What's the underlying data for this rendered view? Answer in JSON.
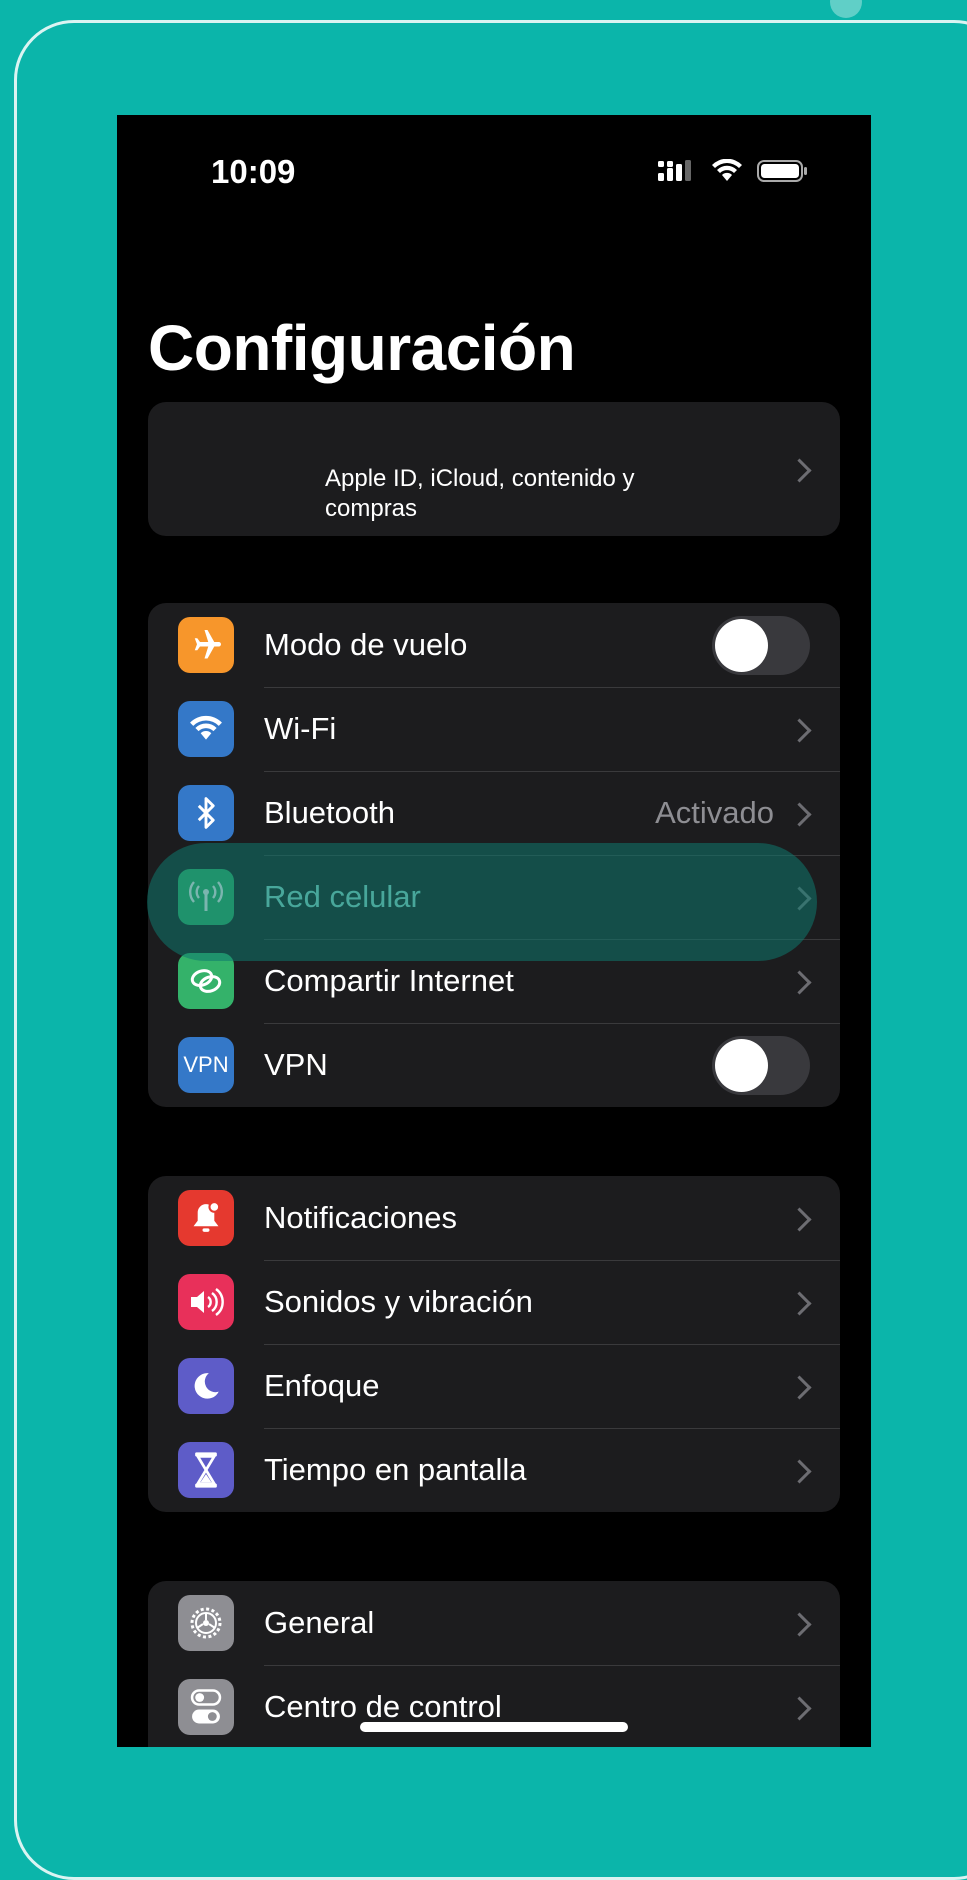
{
  "status_bar": {
    "time": "10:09"
  },
  "page": {
    "title": "Configuración"
  },
  "account": {
    "subtitle": "Apple ID, iCloud, contenido y compras"
  },
  "groups": {
    "connectivity": [
      {
        "label": "Modo de vuelo",
        "icon": "airplane-icon",
        "color": "#f7962b",
        "control": "toggle",
        "on": false
      },
      {
        "label": "Wi-Fi",
        "icon": "wifi-icon",
        "color": "#3478c8",
        "control": "chevron"
      },
      {
        "label": "Bluetooth",
        "value": "Activado",
        "icon": "bluetooth-icon",
        "color": "#3478c8",
        "control": "chevron"
      },
      {
        "label": "Red celular",
        "icon": "cellular-antenna-icon",
        "color": "#34b26a",
        "control": "chevron",
        "highlighted": true
      },
      {
        "label": "Compartir Internet",
        "icon": "hotspot-icon",
        "color": "#34b26a",
        "control": "chevron"
      },
      {
        "label": "VPN",
        "icon": "vpn-icon",
        "icon_text": "VPN",
        "color": "#3478c8",
        "control": "toggle",
        "on": false
      }
    ],
    "notifications": [
      {
        "label": "Notificaciones",
        "icon": "bell-icon",
        "color": "#e5392f"
      },
      {
        "label": "Sonidos y vibración",
        "icon": "speaker-icon",
        "color": "#e8305a"
      },
      {
        "label": "Enfoque",
        "icon": "moon-icon",
        "color": "#5e5cc8"
      },
      {
        "label": "Tiempo en pantalla",
        "icon": "hourglass-icon",
        "color": "#5e5cc8"
      }
    ],
    "general": [
      {
        "label": "General",
        "icon": "gear-icon",
        "color": "#8e8e93"
      },
      {
        "label": "Centro de control",
        "icon": "switches-icon",
        "color": "#8e8e93"
      }
    ]
  },
  "colors": {
    "background": "#0bb5aa",
    "accent_highlight": "#0e786e"
  }
}
